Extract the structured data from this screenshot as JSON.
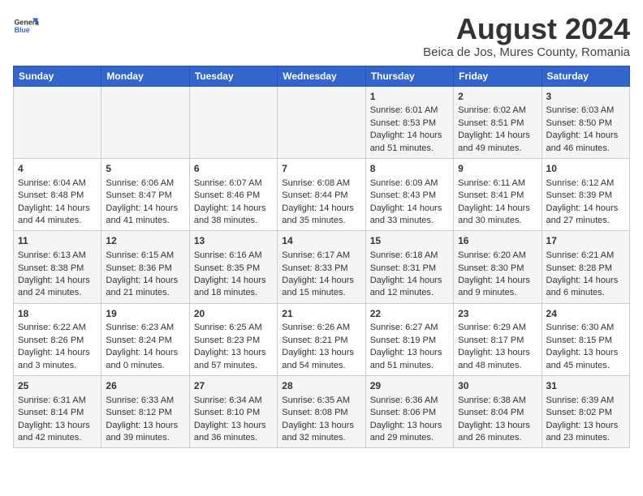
{
  "header": {
    "logo": {
      "general": "General",
      "blue": "Blue"
    },
    "month_title": "August 2024",
    "subtitle": "Beica de Jos, Mures County, Romania"
  },
  "days_of_week": [
    "Sunday",
    "Monday",
    "Tuesday",
    "Wednesday",
    "Thursday",
    "Friday",
    "Saturday"
  ],
  "weeks": [
    [
      {
        "day": "",
        "content": ""
      },
      {
        "day": "",
        "content": ""
      },
      {
        "day": "",
        "content": ""
      },
      {
        "day": "",
        "content": ""
      },
      {
        "day": "1",
        "content": "Sunrise: 6:01 AM\nSunset: 8:53 PM\nDaylight: 14 hours and 51 minutes."
      },
      {
        "day": "2",
        "content": "Sunrise: 6:02 AM\nSunset: 8:51 PM\nDaylight: 14 hours and 49 minutes."
      },
      {
        "day": "3",
        "content": "Sunrise: 6:03 AM\nSunset: 8:50 PM\nDaylight: 14 hours and 46 minutes."
      }
    ],
    [
      {
        "day": "4",
        "content": "Sunrise: 6:04 AM\nSunset: 8:48 PM\nDaylight: 14 hours and 44 minutes."
      },
      {
        "day": "5",
        "content": "Sunrise: 6:06 AM\nSunset: 8:47 PM\nDaylight: 14 hours and 41 minutes."
      },
      {
        "day": "6",
        "content": "Sunrise: 6:07 AM\nSunset: 8:46 PM\nDaylight: 14 hours and 38 minutes."
      },
      {
        "day": "7",
        "content": "Sunrise: 6:08 AM\nSunset: 8:44 PM\nDaylight: 14 hours and 35 minutes."
      },
      {
        "day": "8",
        "content": "Sunrise: 6:09 AM\nSunset: 8:43 PM\nDaylight: 14 hours and 33 minutes."
      },
      {
        "day": "9",
        "content": "Sunrise: 6:11 AM\nSunset: 8:41 PM\nDaylight: 14 hours and 30 minutes."
      },
      {
        "day": "10",
        "content": "Sunrise: 6:12 AM\nSunset: 8:39 PM\nDaylight: 14 hours and 27 minutes."
      }
    ],
    [
      {
        "day": "11",
        "content": "Sunrise: 6:13 AM\nSunset: 8:38 PM\nDaylight: 14 hours and 24 minutes."
      },
      {
        "day": "12",
        "content": "Sunrise: 6:15 AM\nSunset: 8:36 PM\nDaylight: 14 hours and 21 minutes."
      },
      {
        "day": "13",
        "content": "Sunrise: 6:16 AM\nSunset: 8:35 PM\nDaylight: 14 hours and 18 minutes."
      },
      {
        "day": "14",
        "content": "Sunrise: 6:17 AM\nSunset: 8:33 PM\nDaylight: 14 hours and 15 minutes."
      },
      {
        "day": "15",
        "content": "Sunrise: 6:18 AM\nSunset: 8:31 PM\nDaylight: 14 hours and 12 minutes."
      },
      {
        "day": "16",
        "content": "Sunrise: 6:20 AM\nSunset: 8:30 PM\nDaylight: 14 hours and 9 minutes."
      },
      {
        "day": "17",
        "content": "Sunrise: 6:21 AM\nSunset: 8:28 PM\nDaylight: 14 hours and 6 minutes."
      }
    ],
    [
      {
        "day": "18",
        "content": "Sunrise: 6:22 AM\nSunset: 8:26 PM\nDaylight: 14 hours and 3 minutes."
      },
      {
        "day": "19",
        "content": "Sunrise: 6:23 AM\nSunset: 8:24 PM\nDaylight: 14 hours and 0 minutes."
      },
      {
        "day": "20",
        "content": "Sunrise: 6:25 AM\nSunset: 8:23 PM\nDaylight: 13 hours and 57 minutes."
      },
      {
        "day": "21",
        "content": "Sunrise: 6:26 AM\nSunset: 8:21 PM\nDaylight: 13 hours and 54 minutes."
      },
      {
        "day": "22",
        "content": "Sunrise: 6:27 AM\nSunset: 8:19 PM\nDaylight: 13 hours and 51 minutes."
      },
      {
        "day": "23",
        "content": "Sunrise: 6:29 AM\nSunset: 8:17 PM\nDaylight: 13 hours and 48 minutes."
      },
      {
        "day": "24",
        "content": "Sunrise: 6:30 AM\nSunset: 8:15 PM\nDaylight: 13 hours and 45 minutes."
      }
    ],
    [
      {
        "day": "25",
        "content": "Sunrise: 6:31 AM\nSunset: 8:14 PM\nDaylight: 13 hours and 42 minutes."
      },
      {
        "day": "26",
        "content": "Sunrise: 6:33 AM\nSunset: 8:12 PM\nDaylight: 13 hours and 39 minutes."
      },
      {
        "day": "27",
        "content": "Sunrise: 6:34 AM\nSunset: 8:10 PM\nDaylight: 13 hours and 36 minutes."
      },
      {
        "day": "28",
        "content": "Sunrise: 6:35 AM\nSunset: 8:08 PM\nDaylight: 13 hours and 32 minutes."
      },
      {
        "day": "29",
        "content": "Sunrise: 6:36 AM\nSunset: 8:06 PM\nDaylight: 13 hours and 29 minutes."
      },
      {
        "day": "30",
        "content": "Sunrise: 6:38 AM\nSunset: 8:04 PM\nDaylight: 13 hours and 26 minutes."
      },
      {
        "day": "31",
        "content": "Sunrise: 6:39 AM\nSunset: 8:02 PM\nDaylight: 13 hours and 23 minutes."
      }
    ]
  ]
}
